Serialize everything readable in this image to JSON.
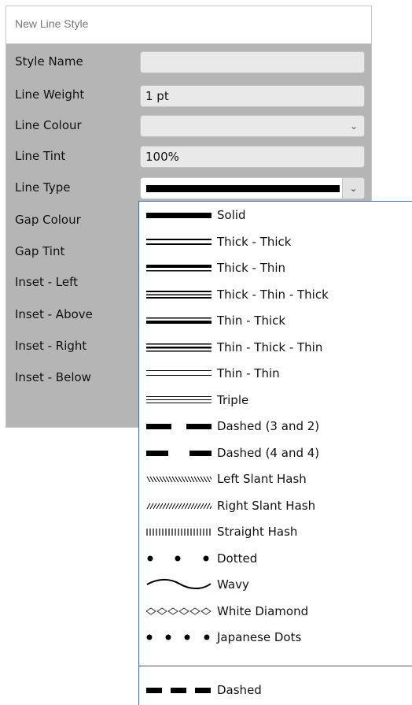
{
  "dialog": {
    "title": "New Line Style",
    "fields": [
      {
        "label": "Style Name",
        "value": ""
      },
      {
        "label": "Line Weight",
        "value": "1 pt"
      },
      {
        "label": "Line Colour",
        "value": ""
      },
      {
        "label": "Line Tint",
        "value": "100%"
      },
      {
        "label": "Line Type",
        "value": ""
      },
      {
        "label": "Gap Colour"
      },
      {
        "label": "Gap Tint"
      },
      {
        "label": "Inset - Left"
      },
      {
        "label": "Inset - Above"
      },
      {
        "label": "Inset - Right"
      },
      {
        "label": "Inset - Below"
      }
    ]
  },
  "dropdown": {
    "options": [
      {
        "label": "Solid",
        "icon": "solid-line-icon"
      },
      {
        "label": "Thick - Thick",
        "icon": "thick-thick-line-icon"
      },
      {
        "label": "Thick - Thin",
        "icon": "thick-thin-line-icon"
      },
      {
        "label": "Thick - Thin - Thick",
        "icon": "thick-thin-thick-line-icon"
      },
      {
        "label": "Thin - Thick",
        "icon": "thin-thick-line-icon"
      },
      {
        "label": "Thin - Thick - Thin",
        "icon": "thin-thick-thin-line-icon"
      },
      {
        "label": "Thin - Thin",
        "icon": "thin-thin-line-icon"
      },
      {
        "label": "Triple",
        "icon": "triple-line-icon"
      },
      {
        "label": "Dashed (3 and 2)",
        "icon": "dashed-3-2-line-icon"
      },
      {
        "label": "Dashed (4 and 4)",
        "icon": "dashed-4-4-line-icon"
      },
      {
        "label": "Left Slant Hash",
        "icon": "left-slant-hash-icon"
      },
      {
        "label": "Right Slant Hash",
        "icon": "right-slant-hash-icon"
      },
      {
        "label": "Straight Hash",
        "icon": "straight-hash-icon"
      },
      {
        "label": "Dotted",
        "icon": "dotted-line-icon"
      },
      {
        "label": "Wavy",
        "icon": "wavy-line-icon"
      },
      {
        "label": "White Diamond",
        "icon": "white-diamond-line-icon"
      },
      {
        "label": "Japanese Dots",
        "icon": "japanese-dots-line-icon"
      }
    ],
    "custom_options": [
      {
        "label": "Dashed",
        "icon": "custom-dashed-line-icon"
      }
    ]
  }
}
